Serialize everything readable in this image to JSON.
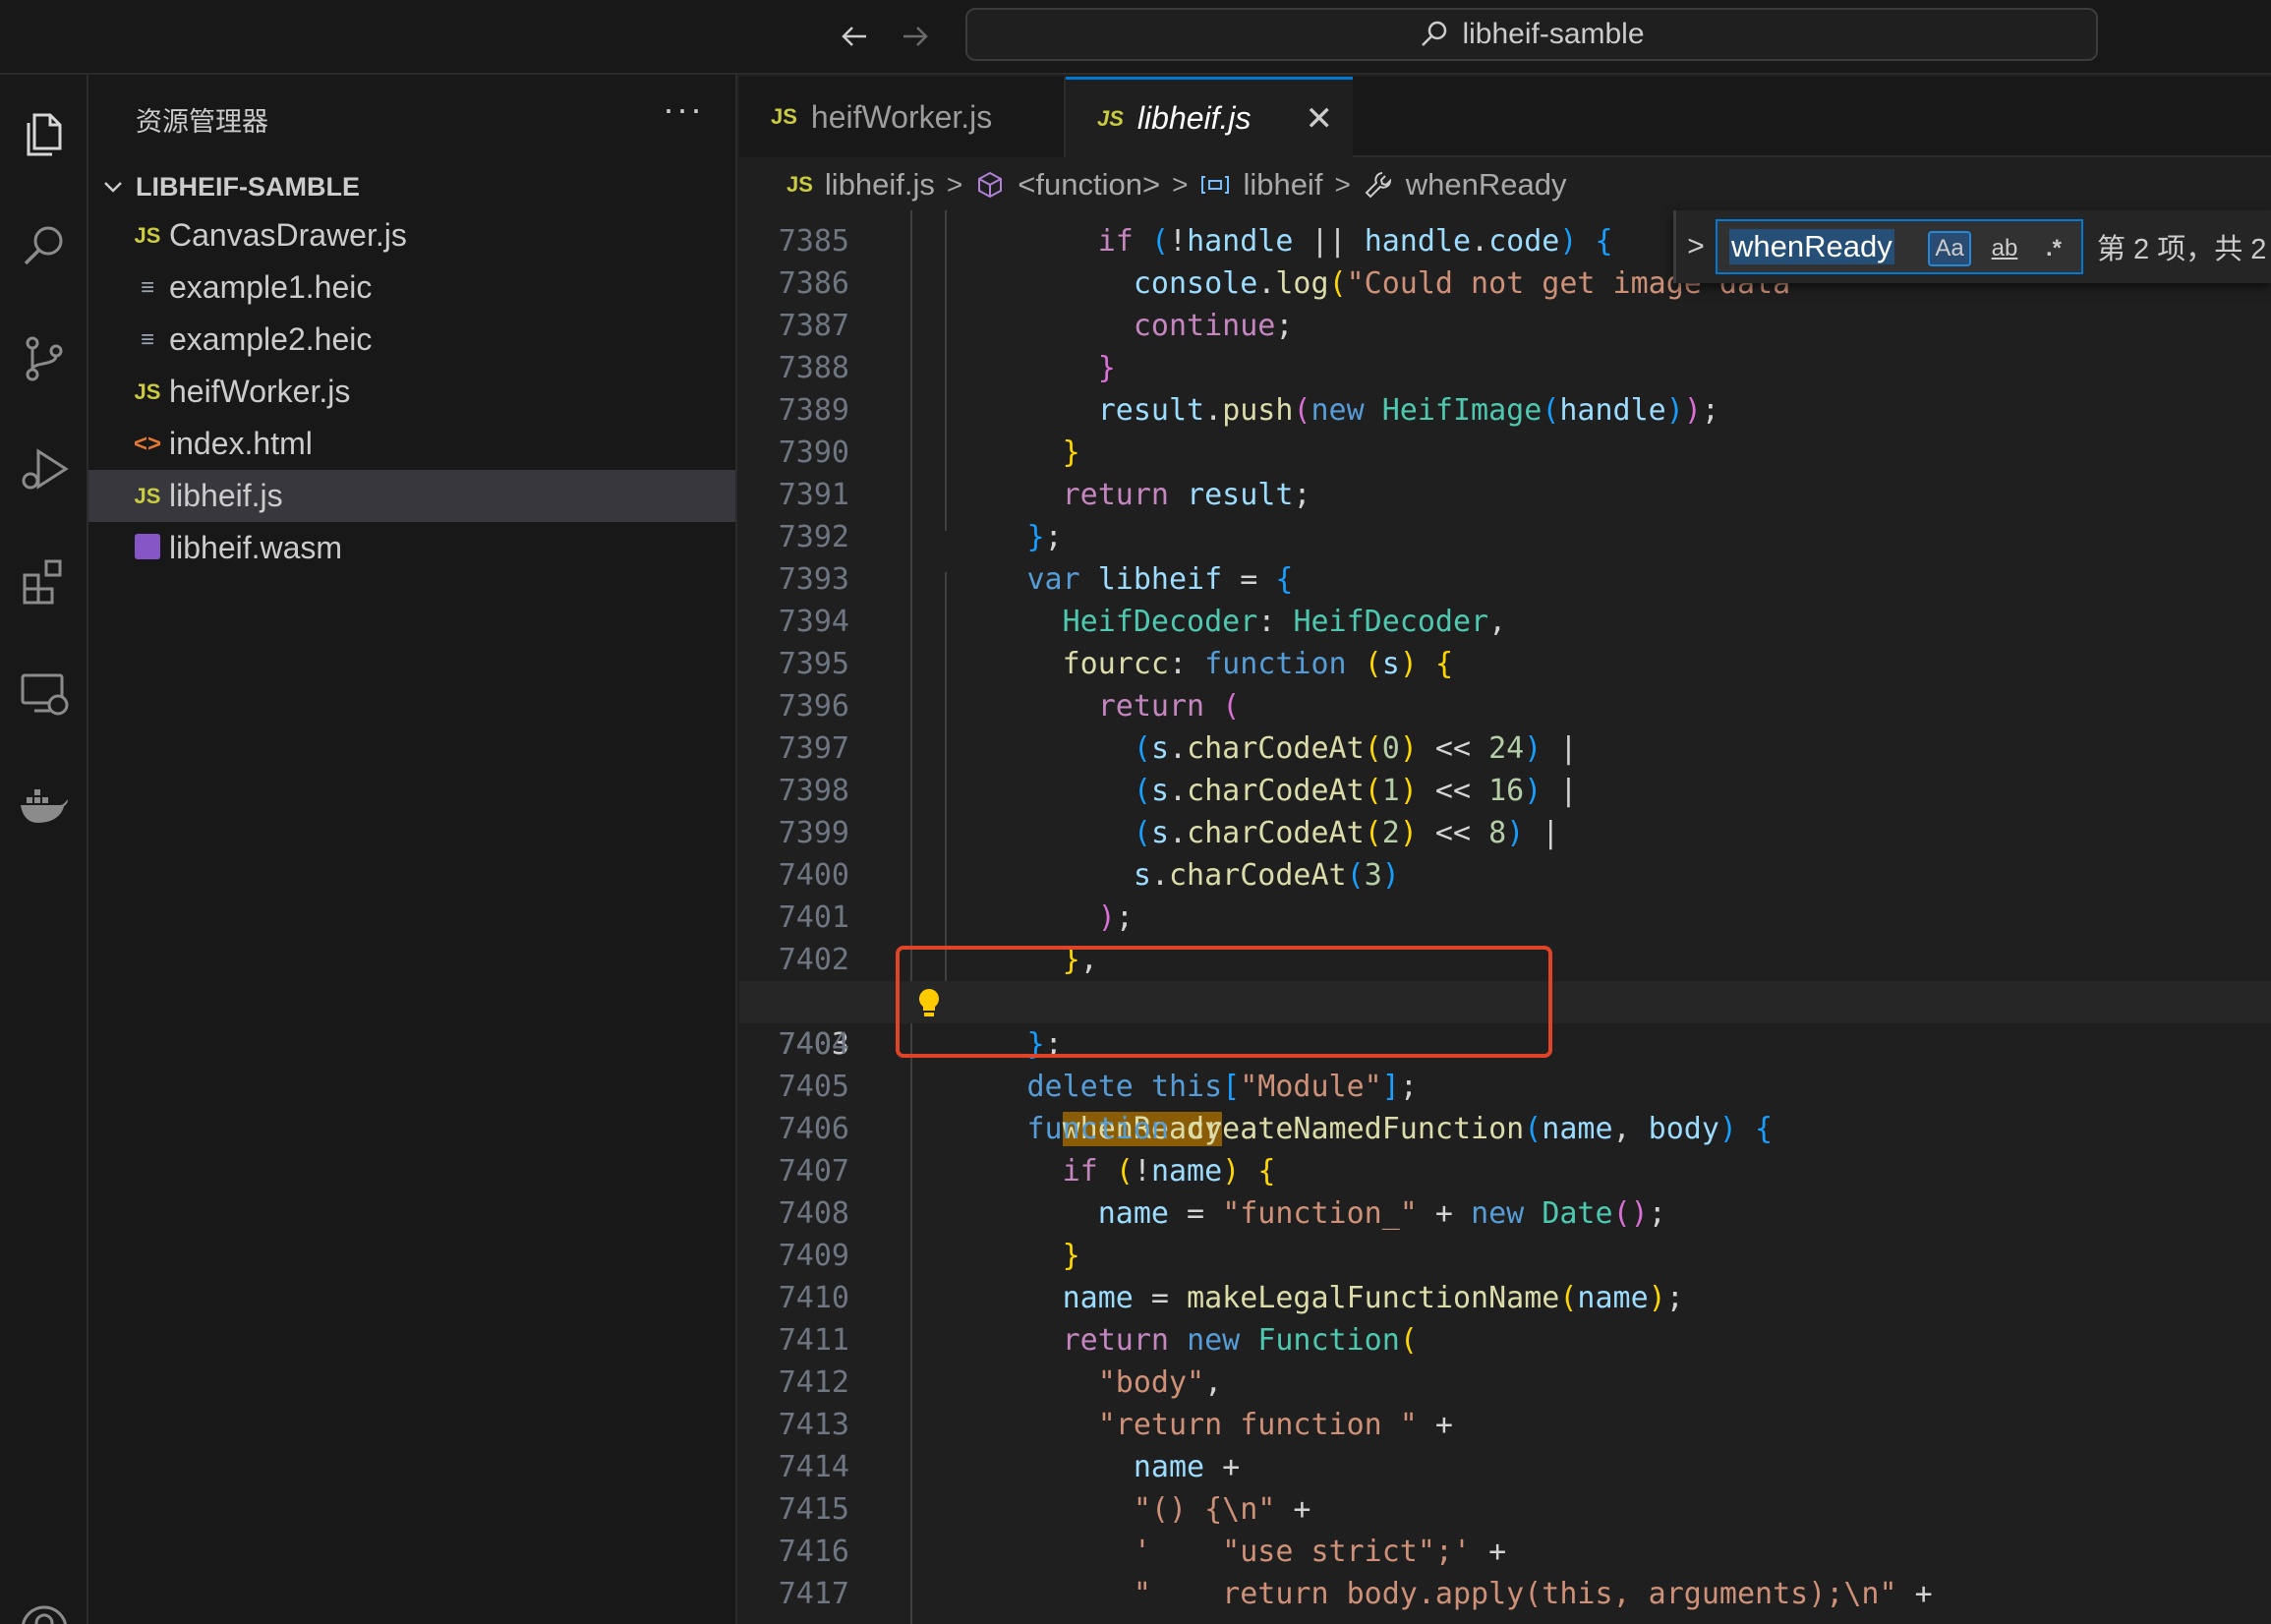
{
  "window": {
    "search_text": "libheif-samble"
  },
  "sidebar": {
    "title": "资源管理器",
    "more": "···",
    "folder": "LIBHEIF-SAMBLE",
    "files": [
      {
        "name": "CanvasDrawer.js",
        "icon": "JS"
      },
      {
        "name": "example1.heic",
        "icon": "≡"
      },
      {
        "name": "example2.heic",
        "icon": "≡"
      },
      {
        "name": "heifWorker.js",
        "icon": "JS"
      },
      {
        "name": "index.html",
        "icon": "<>"
      },
      {
        "name": "libheif.js",
        "icon": "JS"
      },
      {
        "name": "libheif.wasm",
        "icon": "wasm-icon"
      }
    ]
  },
  "tabs": [
    {
      "icon": "JS",
      "label": "heifWorker.js"
    },
    {
      "icon": "JS",
      "label": "libheif.js",
      "close": "✕"
    }
  ],
  "breadcrumbs": {
    "file_icon": "JS",
    "file": "libheif.js",
    "fn": "<function>",
    "var": "libheif",
    "prop": "whenReady",
    "sep": ">"
  },
  "find": {
    "toggle": ">",
    "query": "whenReady",
    "case_label": "Aa",
    "word_label": "ab",
    "regex_label": ".*",
    "count": "第 2 项，共 2"
  },
  "colors": {
    "accent": "#0078d4",
    "annotation": "#e04428",
    "highlight": "#8a5c05"
  },
  "editor": {
    "current_line": "7403",
    "line_numbers": [
      "7385",
      "7386",
      "7387",
      "7388",
      "7389",
      "7390",
      "7391",
      "7392",
      "7393",
      "7394",
      "7395",
      "7396",
      "7397",
      "7398",
      "7399",
      "7400",
      "7401",
      "7402",
      "7403",
      "7404",
      "7405",
      "7406",
      "7407",
      "7408",
      "7409",
      "7410",
      "7411",
      "7412",
      "7413",
      "7414",
      "7415",
      "7416",
      "7417"
    ]
  }
}
